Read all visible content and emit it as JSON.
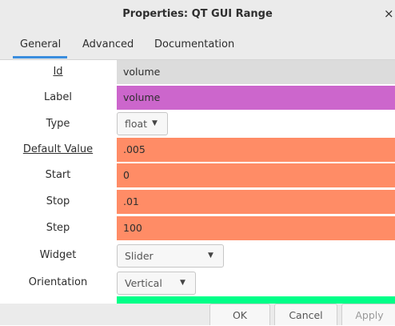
{
  "window": {
    "title": "Properties: QT GUI Range",
    "close_glyph": "×"
  },
  "tabs": [
    {
      "label": "General",
      "active": true
    },
    {
      "label": "Advanced",
      "active": false
    },
    {
      "label": "Documentation",
      "active": false
    }
  ],
  "fields": {
    "id": {
      "label": "Id",
      "value": "volume",
      "color": "#dcdcdc"
    },
    "label": {
      "label": "Label",
      "value": "volume",
      "color": "#cc66cc"
    },
    "type": {
      "label": "Type",
      "value": "float",
      "icon": "dropdown-arrow-icon"
    },
    "default_value": {
      "label": "Default Value",
      "value": ".005",
      "color": "#ff8c66"
    },
    "start": {
      "label": "Start",
      "value": "0",
      "color": "#ff8c66"
    },
    "stop": {
      "label": "Stop",
      "value": ".01",
      "color": "#ff8c66"
    },
    "step": {
      "label": "Step",
      "value": "100",
      "color": "#ff8c66"
    },
    "widget": {
      "label": "Widget",
      "value": "Slider",
      "icon": "dropdown-arrow-icon"
    },
    "orientation": {
      "label": "Orientation",
      "value": "Vertical",
      "icon": "dropdown-arrow-icon"
    },
    "next_field": {
      "color": "#00ff88"
    }
  },
  "buttons": {
    "ok": "OK",
    "cancel": "Cancel",
    "apply": "Apply"
  },
  "arrow_glyph": "▼"
}
